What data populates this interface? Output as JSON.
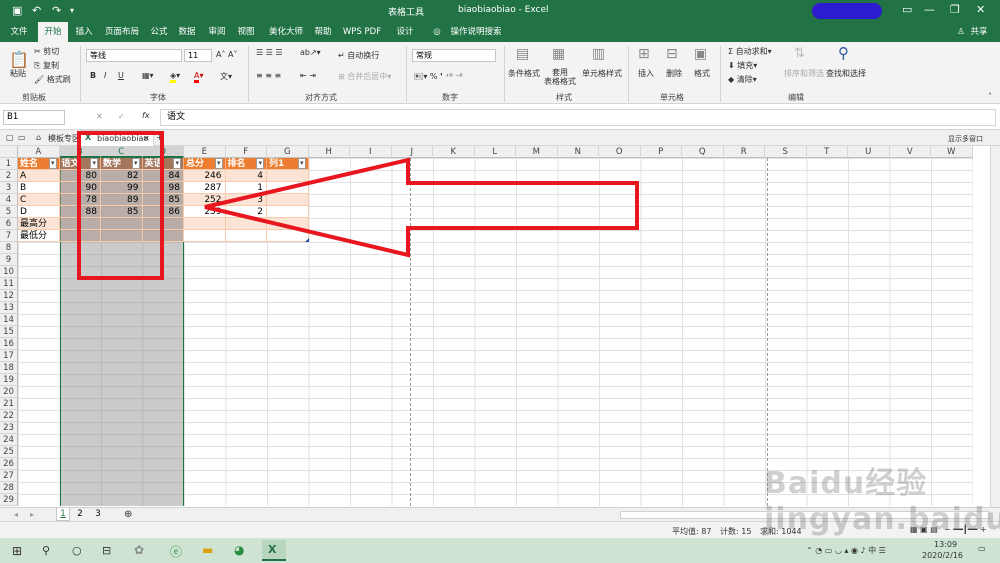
{
  "window": {
    "title": "biaobiaobiao - Excel",
    "context_label": "表格工具"
  },
  "quick_access": [
    "save-icon",
    "undo-icon",
    "redo-icon",
    "customize-icon"
  ],
  "tabs": [
    "文件",
    "开始",
    "插入",
    "页面布局",
    "公式",
    "数据",
    "审阅",
    "视图",
    "美化大师",
    "帮助",
    "WPS PDF",
    "设计"
  ],
  "active_tab": "开始",
  "tell_me": "操作说明搜索",
  "share": "共享",
  "ribbon": {
    "clipboard": {
      "label": "剪贴板",
      "paste": "粘贴",
      "cut": "剪切",
      "copy": "复制",
      "format_painter": "格式刷"
    },
    "font": {
      "label": "字体",
      "font_name": "等线",
      "font_size": "11",
      "bold": "B",
      "italic": "I",
      "underline": "U",
      "font_color_glyph": "A"
    },
    "alignment": {
      "label": "对齐方式",
      "wrap": "自动换行",
      "merge": "合并后居中"
    },
    "number": {
      "label": "数字",
      "format": "常规"
    },
    "styles": {
      "label": "样式",
      "conditional": "条件格式",
      "table": "套用\n表格格式",
      "cell": "单元格样式"
    },
    "cells": {
      "label": "单元格",
      "insert": "插入",
      "delete": "删除",
      "format": "格式"
    },
    "editing": {
      "label": "编辑",
      "autosum": "自动求和",
      "fill": "填充",
      "clear": "清除",
      "sort": "排序和筛选",
      "find": "查找和选择"
    }
  },
  "formula_bar": {
    "name_box": "B1",
    "fx": "fx",
    "value": "语文"
  },
  "file_tabs": {
    "template": "模板专区",
    "workbook": "biaobiaobiao",
    "show_multi": "显示多窗口"
  },
  "columns": [
    "A",
    "B",
    "C",
    "D",
    "E",
    "F",
    "G",
    "H",
    "I",
    "J",
    "K",
    "L",
    "M",
    "N",
    "O",
    "P",
    "Q",
    "R",
    "S",
    "T",
    "U",
    "V",
    "W"
  ],
  "rows": [
    "1",
    "2",
    "3",
    "4",
    "5",
    "6",
    "7",
    "8",
    "9",
    "10",
    "11",
    "12",
    "13",
    "14",
    "15",
    "16",
    "17",
    "18",
    "19",
    "20",
    "21",
    "22",
    "23",
    "24",
    "25",
    "26",
    "27",
    "28",
    "29"
  ],
  "table": {
    "headers": [
      "姓名",
      "语文",
      "数学",
      "英语",
      "总分",
      "排名",
      "列1"
    ],
    "data": [
      [
        "A",
        "80",
        "82",
        "84",
        "246",
        "4",
        ""
      ],
      [
        "B",
        "90",
        "99",
        "98",
        "287",
        "1",
        ""
      ],
      [
        "C",
        "78",
        "89",
        "85",
        "252",
        "3",
        ""
      ],
      [
        "D",
        "88",
        "85",
        "86",
        "259",
        "2",
        ""
      ],
      [
        "最高分",
        "",
        "",
        "",
        "",
        "",
        ""
      ],
      [
        "最低分",
        "",
        "",
        "",
        "",
        "",
        ""
      ]
    ]
  },
  "colors": {
    "accent": "#217346",
    "header_fill": "#ed7d31",
    "band1": "#fbe4d5",
    "band2": "#ffffff",
    "selection": "#c8c8c8",
    "annotation": "#e8161e"
  },
  "sheets": [
    "1",
    "2",
    "3"
  ],
  "active_sheet": "1",
  "status": {
    "average": "平均值: 87",
    "count": "计数: 15",
    "sum": "求和: 1044"
  },
  "taskbar": {
    "time": "13:09",
    "date": "2020/2/16"
  },
  "watermark": "Baidu经验 jingyan.baidu.com"
}
